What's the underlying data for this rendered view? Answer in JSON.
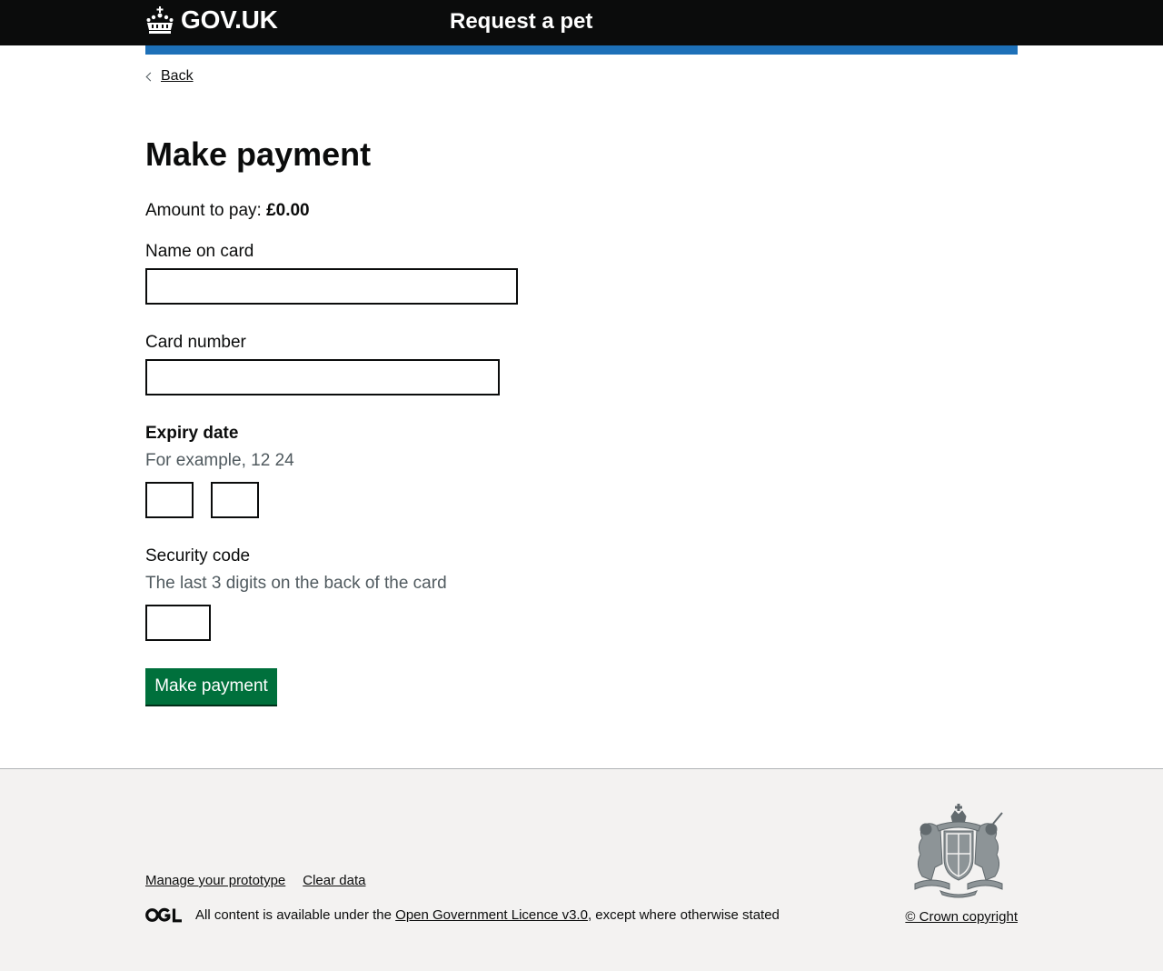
{
  "header": {
    "logo_text": "GOV.UK",
    "service_name": "Request a pet",
    "colors": {
      "header_bg": "#0b0c0c",
      "accent_bar": "#1d70b8"
    }
  },
  "nav": {
    "back_label": "Back"
  },
  "main": {
    "title": "Make payment",
    "amount_label": "Amount to pay:",
    "amount_value": "£0.00",
    "fields": {
      "name_on_card": {
        "label": "Name on card",
        "value": ""
      },
      "card_number": {
        "label": "Card number",
        "value": ""
      },
      "expiry": {
        "label": "Expiry date",
        "hint": "For example, 12 24",
        "month_value": "",
        "year_value": ""
      },
      "security_code": {
        "label": "Security code",
        "hint": "The last 3 digits on the back of the card",
        "value": ""
      }
    },
    "submit_label": "Make payment",
    "button_color": "#00703c"
  },
  "footer": {
    "links": [
      "Manage your prototype",
      "Clear data"
    ],
    "licence_prefix": "All content is available under the",
    "licence_link": "Open Government Licence v3.0",
    "licence_suffix": ", except where otherwise stated",
    "copyright": "© Crown copyright",
    "icons": [
      "ogl-logo-icon",
      "royal-coat-of-arms-icon"
    ]
  }
}
